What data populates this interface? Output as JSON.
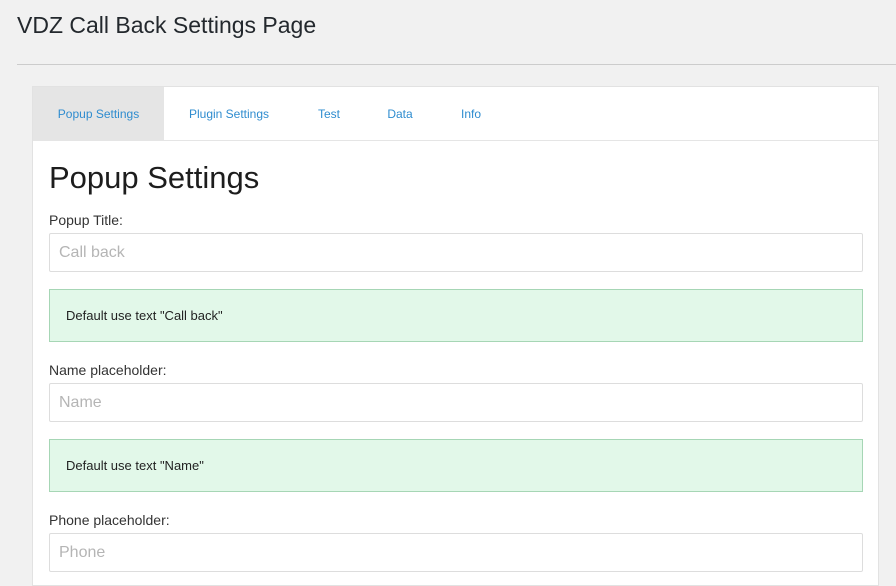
{
  "page_title": "VDZ Call Back Settings Page",
  "tabs": [
    {
      "label": "Popup Settings",
      "active": true
    },
    {
      "label": "Plugin Settings",
      "active": false
    },
    {
      "label": "Test",
      "active": false
    },
    {
      "label": "Data",
      "active": false
    },
    {
      "label": "Info",
      "active": false
    }
  ],
  "section_title": "Popup Settings",
  "fields": [
    {
      "label": "Popup Title:",
      "value": "",
      "placeholder": "Call back",
      "hint": "Default use text \"Call back\""
    },
    {
      "label": "Name placeholder:",
      "value": "",
      "placeholder": "Name",
      "hint": "Default use text \"Name\""
    },
    {
      "label": "Phone placeholder:",
      "value": "",
      "placeholder": "Phone"
    }
  ],
  "colors": {
    "link": "#2e8ccf",
    "active_tab_bg": "#e5e5e5",
    "hint_bg": "#e2f8e9",
    "hint_border": "#a6d6b5"
  }
}
